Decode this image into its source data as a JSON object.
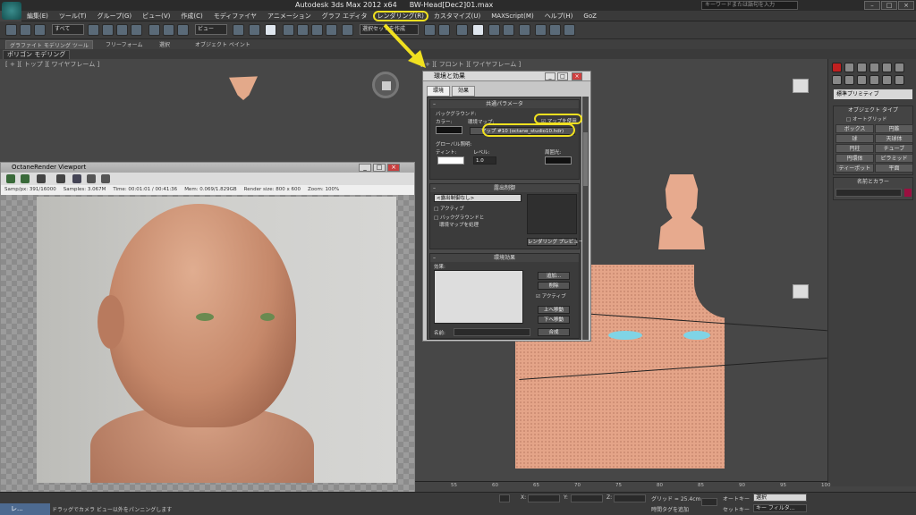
{
  "window": {
    "app_title": "Autodesk 3ds Max  2012 x64",
    "file_title": "BW-Head[Dec2]01.max",
    "search_placeholder": "キーワードまたは語句を入力"
  },
  "menu": [
    "編集(E)",
    "ツール(T)",
    "グループ(G)",
    "ビュー(V)",
    "作成(C)",
    "モディファイヤ",
    "アニメーション",
    "グラフ エディタ",
    "レンダリング(R)",
    "カスタマイズ(U)",
    "MAXScript(M)",
    "ヘルプ(H)",
    "GoZ"
  ],
  "toolbar": {
    "selection_filter": "すべて",
    "ref_coord": "ビュー",
    "named_sel": "選択セットを作成"
  },
  "ribbon_tabs": [
    "グラファイト モデリング ツール",
    "フリーフォーム",
    "選択",
    "オブジェクト ペイント"
  ],
  "ribbon_active": "ポリゴン モデリング",
  "viewports": {
    "top_label": "[ + ][ トップ ][ ワイヤフレーム ]",
    "front_label": "[ + ][ フロント ][ ワイヤフレーム ]"
  },
  "octane": {
    "title": "OctaneRender Viewport",
    "stats": [
      "Samp/px: 391/16000",
      "Samples: 3.067M",
      "Time: 00:01:01 / 00:41:36",
      "Mem: 0.069/1.829GB",
      "Render size: 800 x 600",
      "Zoom: 100%"
    ]
  },
  "env_dialog": {
    "title": "環境と効果",
    "tabs": [
      "環境",
      "効果"
    ],
    "common_params": "共通パラメータ",
    "background": "バックグラウンド:",
    "color": "カラー:",
    "env_map": "環境マップ:",
    "use_map": "マップを使用",
    "map_name": "マップ #10 (octane_studio10.hdr)",
    "global_lighting": "グローバル照明:",
    "tint": "ティント:",
    "level": "レベル:",
    "level_value": "1.0",
    "ambient": "周囲光:",
    "exposure_control": "露出制御",
    "exposure_none": "<露出制御なし>",
    "active": "アクティブ",
    "process_bg1": "バックグラウンドと",
    "process_bg2": "環境マップを処理",
    "render_preview": "レンダリング プレビュー",
    "atmosphere": "環境効果",
    "effects": "効果:",
    "add": "追加...",
    "delete": "削除",
    "active2": "アクティブ",
    "move_up": "上へ移動",
    "move_down": "下へ移動",
    "name": "名前:",
    "merge": "合成"
  },
  "cmd_panel": {
    "dropdown": "標準プリミティブ",
    "object_type": "オブジェクト タイプ",
    "autogrid": "オートグリッド",
    "buttons": [
      "ボックス",
      "円錐",
      "球",
      "天球体",
      "円柱",
      "チューブ",
      "円環体",
      "ピラミッド",
      "ティーポット",
      "平面"
    ],
    "name_color": "名前とカラー"
  },
  "ruler": [
    "55",
    "60",
    "65",
    "70",
    "75",
    "80",
    "85",
    "90",
    "95",
    "100"
  ],
  "status": {
    "x_label": "X:",
    "y_label": "Y:",
    "z_label": "Z:",
    "grid": "グリッド = 25.4cm",
    "auto_key": "オートキー",
    "set_key": "セットキー",
    "selection": "選択",
    "key_filter": "キー フィルタ...",
    "add_time_tag": "時間タグを追加",
    "prompt": "ドラッグでカメラ ビュー以外をパンニングします",
    "task": "レ..."
  },
  "colors": {
    "highlight": "#f0e020",
    "skin": "#e4a488",
    "eye": "#7fd4e6"
  }
}
